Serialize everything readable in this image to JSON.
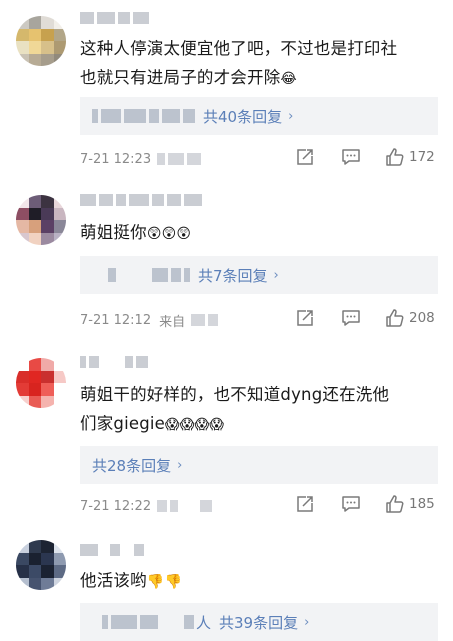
{
  "comments": [
    {
      "text_line1": "这种人停演太便宜他了吧，不过也是打印社",
      "text_line2": "也就只有进局子的才会开除",
      "emojis": [
        "😂"
      ],
      "reply_link": "共40条回复",
      "time": "7-21 12:23",
      "source": "",
      "likes": "172",
      "avatar_colors": [
        "#ccc9c2",
        "#a8a59d",
        "#e0dcd6",
        "#f2efe9",
        "#d5b86c",
        "#e6c26f",
        "#c7a14e",
        "#b2a688",
        "#e9e1c2",
        "#f0d897",
        "#d7c08a",
        "#ad9a72",
        "#c9c2b4",
        "#b7ab95",
        "#a69d8c",
        "#918a7c"
      ]
    },
    {
      "text_line1": "萌姐挺你",
      "text_line2": "",
      "emojis": [
        "😲",
        "😲",
        "😲"
      ],
      "reply_link": "共7条回复",
      "time": "7-21 12:12",
      "source": "来自",
      "likes": "208",
      "avatar_colors": [
        "#f2e6ea",
        "#6d5d78",
        "#3c3341",
        "#e8d6da",
        "#8d4e63",
        "#1f1d27",
        "#4a3a57",
        "#c9b6c0",
        "#e5b8a4",
        "#d7a07c",
        "#5b4065",
        "#8a8798",
        "#d8c7cf",
        "#f1d2c1",
        "#9b8aa0",
        "#b9b2c4"
      ]
    },
    {
      "text_line1": "萌姐干的好样的，也不知道dyng还在洗他",
      "text_line2": "们家giegie",
      "emojis": [
        "😱",
        "😱",
        "😱",
        "😱"
      ],
      "reply_link": "共28条回复",
      "time": "7-21 12:22",
      "source": "",
      "likes": "185",
      "avatar_colors": [
        "#ffffff",
        "#e84a45",
        "#f0aaa8",
        "#ffffff",
        "#d92e2a",
        "#e02722",
        "#c9302f",
        "#f6c9c6",
        "#e33b36",
        "#d8241f",
        "#ef5e58",
        "#ffffff",
        "#f7d0cd",
        "#e95c55",
        "#f5b3ae",
        "#ffffff"
      ]
    },
    {
      "text_line1": "他活该哟",
      "text_line2": "",
      "emojis": [
        "👎",
        "👎"
      ],
      "reply_link": "共39条回复",
      "reply_prefix": "人",
      "avatar_colors": [
        "#c8d0de",
        "#2f3a4e",
        "#1d2433",
        "#dde3ec",
        "#3a4862",
        "#1a2130",
        "#2b3650",
        "#8e9ab0",
        "#263047",
        "#3c4a66",
        "#1b2232",
        "#5d6a84",
        "#b5bfcf",
        "#46536f",
        "#6f7c97",
        "#cfd5e0"
      ]
    }
  ],
  "colors": {
    "link": "#5b7fb8",
    "meta_text": "#8a8a8a",
    "reply_bg": "#f2f3f5"
  },
  "icons": [
    "share-icon",
    "comment-icon",
    "thumbs-up-icon",
    "chevron-right-icon"
  ]
}
